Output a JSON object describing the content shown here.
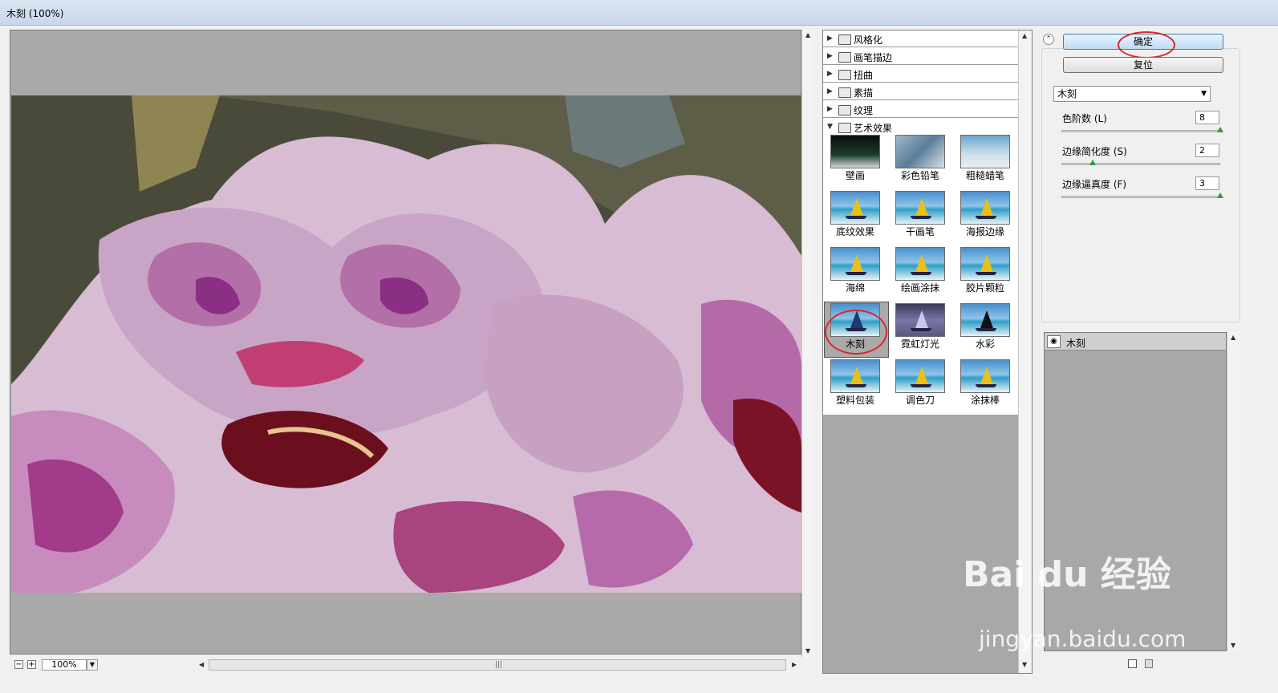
{
  "window": {
    "title": "木刻 (100%)"
  },
  "preview": {
    "zoom": "100%"
  },
  "filter_categories": [
    {
      "label": "风格化",
      "expanded": false
    },
    {
      "label": "画笔描边",
      "expanded": false
    },
    {
      "label": "扭曲",
      "expanded": false
    },
    {
      "label": "素描",
      "expanded": false
    },
    {
      "label": "纹理",
      "expanded": false
    },
    {
      "label": "艺术效果",
      "expanded": true
    }
  ],
  "artistic_filters": [
    {
      "label": "壁画",
      "selected": false
    },
    {
      "label": "彩色铅笔",
      "selected": false
    },
    {
      "label": "粗糙蜡笔",
      "selected": false
    },
    {
      "label": "底纹效果",
      "selected": false
    },
    {
      "label": "干画笔",
      "selected": false
    },
    {
      "label": "海报边缘",
      "selected": false
    },
    {
      "label": "海绵",
      "selected": false
    },
    {
      "label": "绘画涂抹",
      "selected": false
    },
    {
      "label": "胶片颗粒",
      "selected": false
    },
    {
      "label": "木刻",
      "selected": true
    },
    {
      "label": "霓虹灯光",
      "selected": false
    },
    {
      "label": "水彩",
      "selected": false
    },
    {
      "label": "塑料包装",
      "selected": false
    },
    {
      "label": "调色刀",
      "selected": false
    },
    {
      "label": "涂抹棒",
      "selected": false
    }
  ],
  "buttons": {
    "ok": "确定",
    "reset": "复位"
  },
  "filter_select": {
    "value": "木刻"
  },
  "params": [
    {
      "label": "色阶数 (L)",
      "value": "8",
      "fraction": 1.0
    },
    {
      "label": "边缘简化度 (S)",
      "value": "2",
      "fraction": 0.2
    },
    {
      "label": "边缘逼真度 (F)",
      "value": "3",
      "fraction": 1.0
    }
  ],
  "layers": {
    "active": "木刻"
  },
  "watermark": {
    "brand": "Bai du 经验",
    "url": "jingyan.baidu.com"
  },
  "colors": {
    "highlight_ring": "#d9262c",
    "ok_button": "#bedcf2",
    "panel_gray": "#a8a8a8"
  }
}
